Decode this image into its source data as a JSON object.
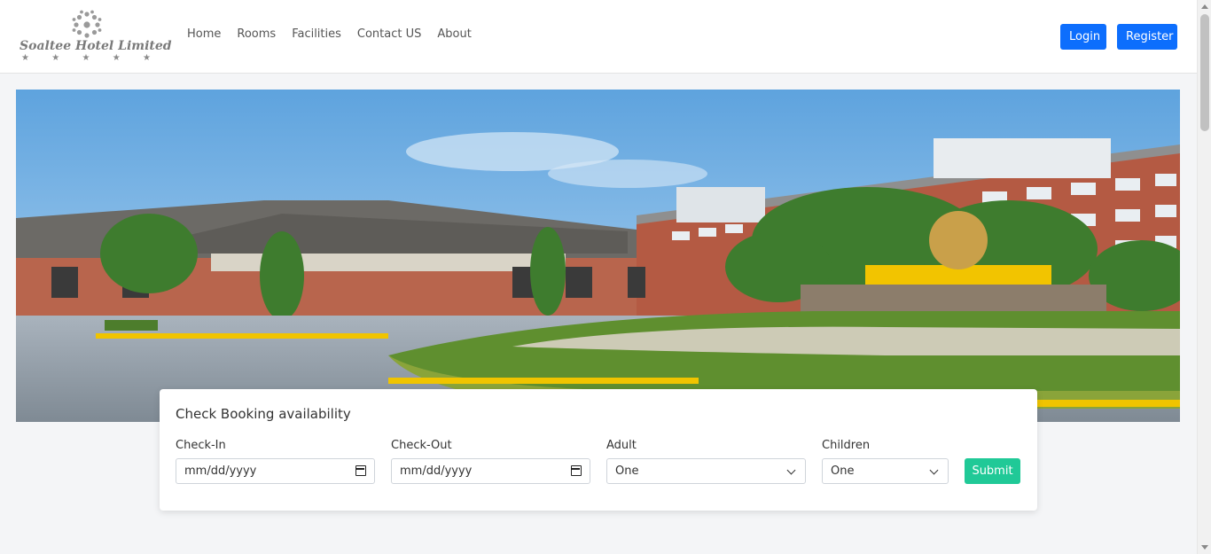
{
  "brand": {
    "name": "Soaltee Hotel Limited",
    "stars": [
      "★",
      "★",
      "★",
      "★",
      "★"
    ]
  },
  "nav": {
    "links": [
      {
        "label": "Home"
      },
      {
        "label": "Rooms"
      },
      {
        "label": "Facilities"
      },
      {
        "label": "Contact US"
      },
      {
        "label": "About"
      }
    ],
    "login_label": "Login",
    "register_label": "Register"
  },
  "booking": {
    "title": "Check Booking availability",
    "checkin_label": "Check-In",
    "checkin_placeholder": "mm/dd/yyyy",
    "checkout_label": "Check-Out",
    "checkout_placeholder": "mm/dd/yyyy",
    "adult_label": "Adult",
    "adult_value": "One",
    "children_label": "Children",
    "children_value": "One",
    "submit_label": "Submit"
  },
  "colors": {
    "primary": "#0d6efd",
    "submit": "#20c997",
    "background": "#f4f5f7"
  }
}
